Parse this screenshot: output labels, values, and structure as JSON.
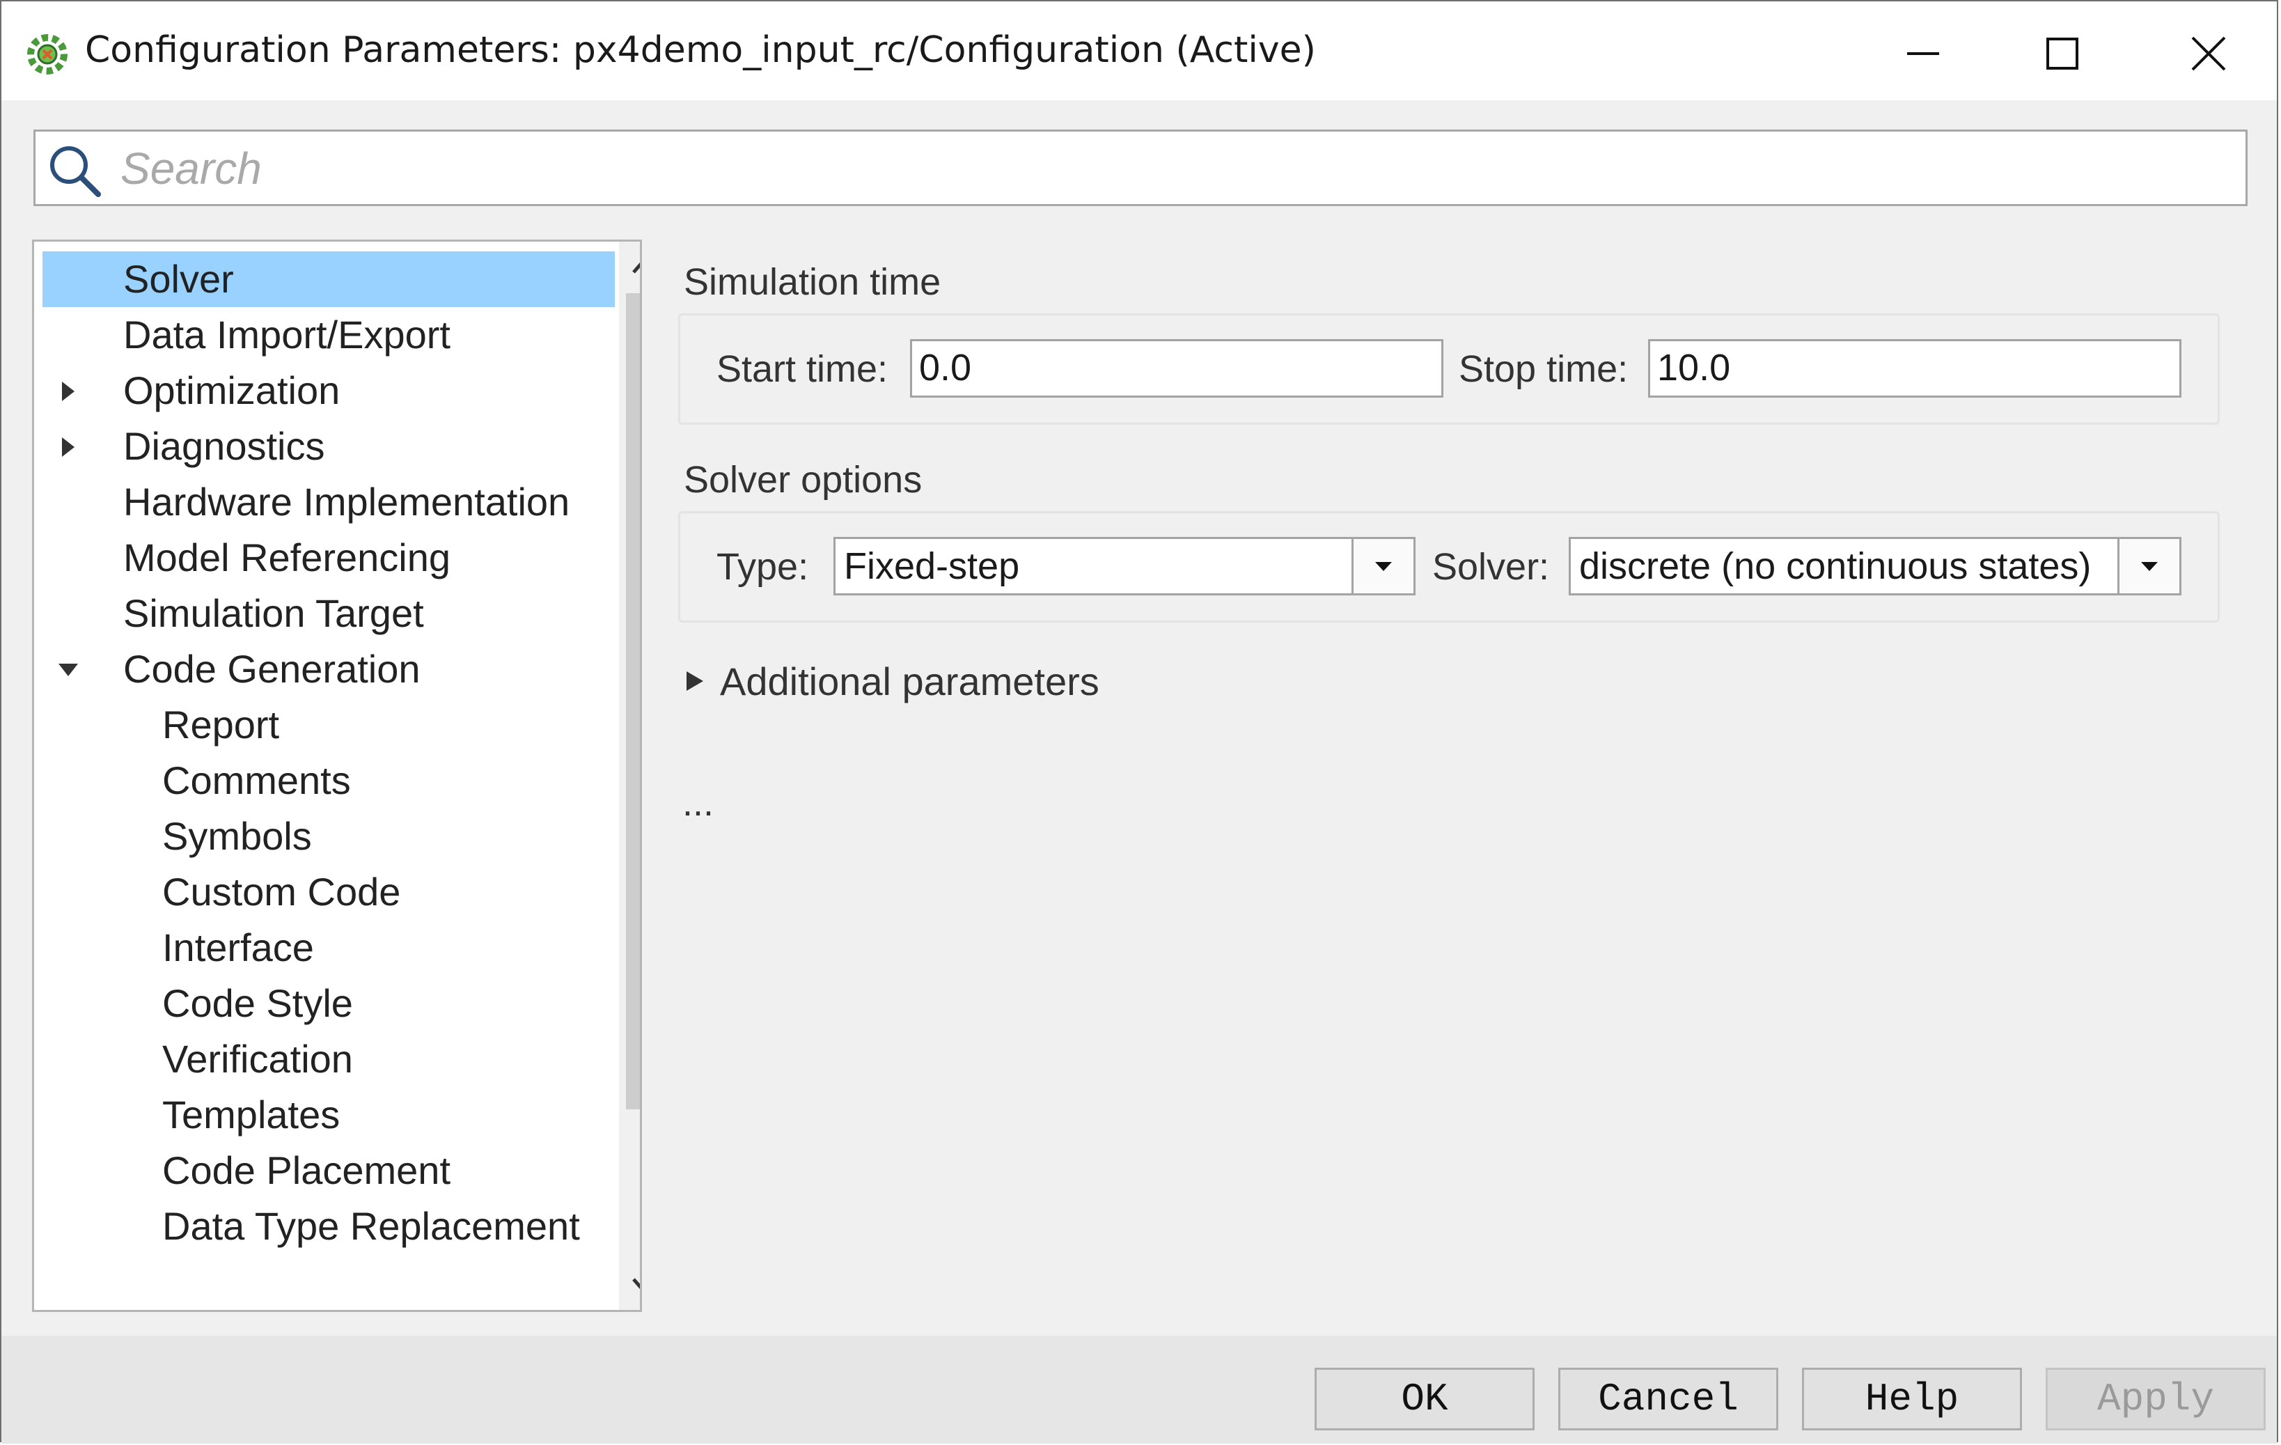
{
  "window": {
    "title": "Configuration Parameters: px4demo_input_rc/Configuration (Active)",
    "controls": [
      "minimize-icon",
      "maximize-icon",
      "close-icon"
    ]
  },
  "search": {
    "placeholder": "Search",
    "value": ""
  },
  "tree": {
    "selected": "Solver",
    "items": [
      {
        "label": "Solver",
        "level": 0,
        "expander": "none"
      },
      {
        "label": "Data Import/Export",
        "level": 0,
        "expander": "none"
      },
      {
        "label": "Optimization",
        "level": 0,
        "expander": "collapsed"
      },
      {
        "label": "Diagnostics",
        "level": 0,
        "expander": "collapsed"
      },
      {
        "label": "Hardware Implementation",
        "level": 0,
        "expander": "none"
      },
      {
        "label": "Model Referencing",
        "level": 0,
        "expander": "none"
      },
      {
        "label": "Simulation Target",
        "level": 0,
        "expander": "none"
      },
      {
        "label": "Code Generation",
        "level": 0,
        "expander": "expanded"
      },
      {
        "label": "Report",
        "level": 1,
        "expander": "none"
      },
      {
        "label": "Comments",
        "level": 1,
        "expander": "none"
      },
      {
        "label": "Symbols",
        "level": 1,
        "expander": "none"
      },
      {
        "label": "Custom Code",
        "level": 1,
        "expander": "none"
      },
      {
        "label": "Interface",
        "level": 1,
        "expander": "none"
      },
      {
        "label": "Code Style",
        "level": 1,
        "expander": "none"
      },
      {
        "label": "Verification",
        "level": 1,
        "expander": "none"
      },
      {
        "label": "Templates",
        "level": 1,
        "expander": "none"
      },
      {
        "label": "Code Placement",
        "level": 1,
        "expander": "none"
      },
      {
        "label": "Data Type Replacement",
        "level": 1,
        "expander": "none"
      }
    ]
  },
  "simulation_time": {
    "heading": "Simulation time",
    "start_label": "Start time:",
    "start_value": "0.0",
    "stop_label": "Stop time:",
    "stop_value": "10.0"
  },
  "solver_options": {
    "heading": "Solver options",
    "type_label": "Type:",
    "type_value": "Fixed-step",
    "solver_label": "Solver:",
    "solver_value": "discrete (no continuous states)"
  },
  "additional_parameters": {
    "label": "Additional parameters",
    "expanded": false
  },
  "ellipsis": "...",
  "buttons": {
    "ok": "OK",
    "cancel": "Cancel",
    "help": "Help",
    "apply": "Apply",
    "apply_enabled": false
  },
  "colors": {
    "selection": "#99d1ff",
    "background": "#f0f0f0",
    "app_icon": "#4a9a3c"
  }
}
